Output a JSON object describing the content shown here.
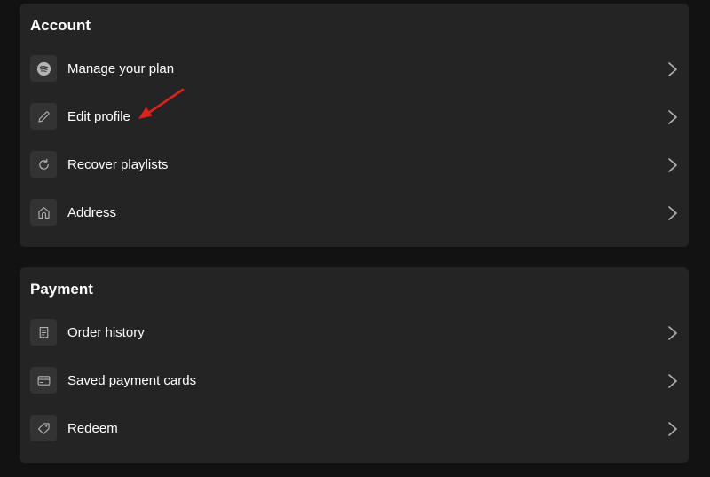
{
  "colors": {
    "background": "#121212",
    "card": "#242424",
    "icon_tile": "#333333",
    "text": "#ffffff",
    "chevron": "#b3b3b3",
    "annotation_arrow": "#e0201b"
  },
  "account": {
    "title": "Account",
    "items": [
      {
        "label": "Manage your plan",
        "icon": "spotify-logo-icon"
      },
      {
        "label": "Edit profile",
        "icon": "pencil-icon"
      },
      {
        "label": "Recover playlists",
        "icon": "refresh-icon"
      },
      {
        "label": "Address",
        "icon": "home-icon"
      }
    ]
  },
  "payment": {
    "title": "Payment",
    "items": [
      {
        "label": "Order history",
        "icon": "receipt-icon"
      },
      {
        "label": "Saved payment cards",
        "icon": "credit-card-icon"
      },
      {
        "label": "Redeem",
        "icon": "tag-icon"
      }
    ]
  },
  "annotation": {
    "type": "arrow",
    "points_to": "Edit profile",
    "color": "red"
  }
}
